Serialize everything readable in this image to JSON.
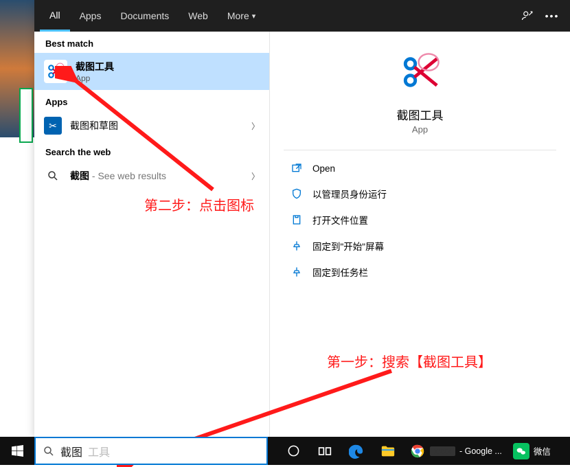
{
  "tabs": {
    "all": "All",
    "apps": "Apps",
    "documents": "Documents",
    "web": "Web",
    "more": "More"
  },
  "sections": {
    "best": "Best match",
    "apps": "Apps",
    "web": "Search the web"
  },
  "best": {
    "title": "截图工具",
    "sub": "App"
  },
  "apps_list": [
    {
      "label": "截图和草图"
    }
  ],
  "web_row": {
    "prefix": "截图",
    "suffix": " - See web results"
  },
  "preview": {
    "title": "截图工具",
    "sub": "App"
  },
  "actions": [
    {
      "label": "Open"
    },
    {
      "label": "以管理员身份运行"
    },
    {
      "label": "打开文件位置"
    },
    {
      "label": "固定到\"开始\"屏幕"
    },
    {
      "label": "固定到任务栏"
    }
  ],
  "annotations": {
    "step1": "第一步：搜索【截图工具】",
    "step2": "第二步：点击图标"
  },
  "search": {
    "value": "截图",
    "placeholder": "工具"
  },
  "taskbar": {
    "chrome_label": " - Google ...",
    "wechat_label": "微信"
  },
  "colors": {
    "accent": "#0078d4",
    "annot": "#ff1a1a"
  }
}
